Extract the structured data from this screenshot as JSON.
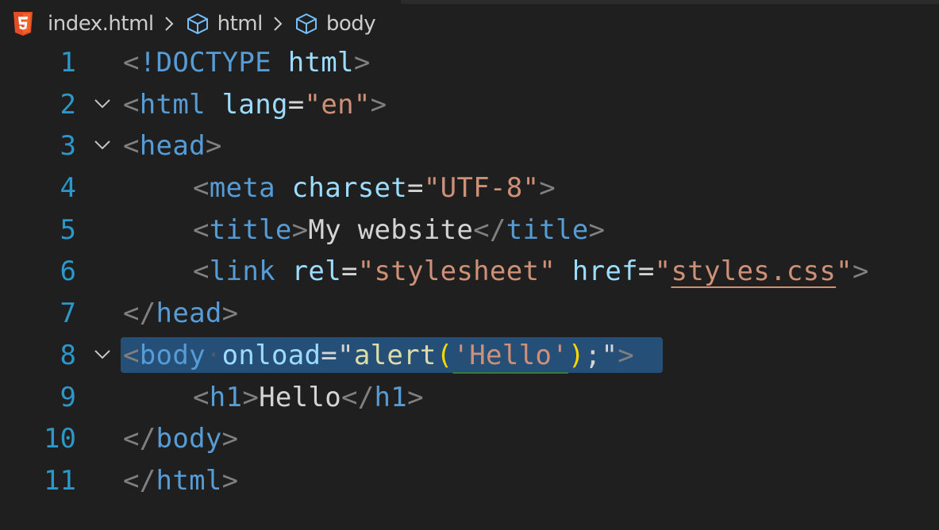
{
  "breadcrumb": {
    "file_icon": "html5-icon",
    "file": "index.html",
    "items": [
      {
        "icon": "cube-icon",
        "label": "html"
      },
      {
        "icon": "cube-icon",
        "label": "body"
      }
    ]
  },
  "colors": {
    "background": "#1f1f1f",
    "line_number": "#2c97c9",
    "tag": "#569cd6",
    "attribute": "#9cdcfe",
    "string": "#ce9178",
    "text": "#d4d4d4",
    "punctuation": "#808080",
    "function": "#dcdcaa",
    "bracket": "#ffd700",
    "selection": "#264f78"
  },
  "editor": {
    "selected_line": 8,
    "lines": [
      {
        "number": "1",
        "foldable": false
      },
      {
        "number": "2",
        "foldable": true
      },
      {
        "number": "3",
        "foldable": true
      },
      {
        "number": "4",
        "foldable": false
      },
      {
        "number": "5",
        "foldable": false
      },
      {
        "number": "6",
        "foldable": false
      },
      {
        "number": "7",
        "foldable": false
      },
      {
        "number": "8",
        "foldable": true
      },
      {
        "number": "9",
        "foldable": false
      },
      {
        "number": "10",
        "foldable": false
      },
      {
        "number": "11",
        "foldable": false
      }
    ],
    "code": {
      "l1": {
        "doctype": "!DOCTYPE",
        "name": "html"
      },
      "l2": {
        "tag": "html",
        "attr": "lang",
        "value": "en"
      },
      "l3": {
        "tag": "head"
      },
      "l4": {
        "tag": "meta",
        "attr": "charset",
        "value": "UTF-8"
      },
      "l5": {
        "tag": "title",
        "text": "My website",
        "close_tag": "title"
      },
      "l6": {
        "tag": "link",
        "attr1": "rel",
        "value1": "stylesheet",
        "attr2": "href",
        "value2": "styles.css"
      },
      "l7": {
        "tag": "head"
      },
      "l8": {
        "tag": "body",
        "attr": "onload",
        "func": "alert",
        "arg": "'Hello'",
        "semicolon": ";"
      },
      "l9": {
        "tag": "h1",
        "text": "Hello",
        "close_tag": "h1"
      },
      "l10": {
        "tag": "body"
      },
      "l11": {
        "tag": "html"
      }
    }
  }
}
